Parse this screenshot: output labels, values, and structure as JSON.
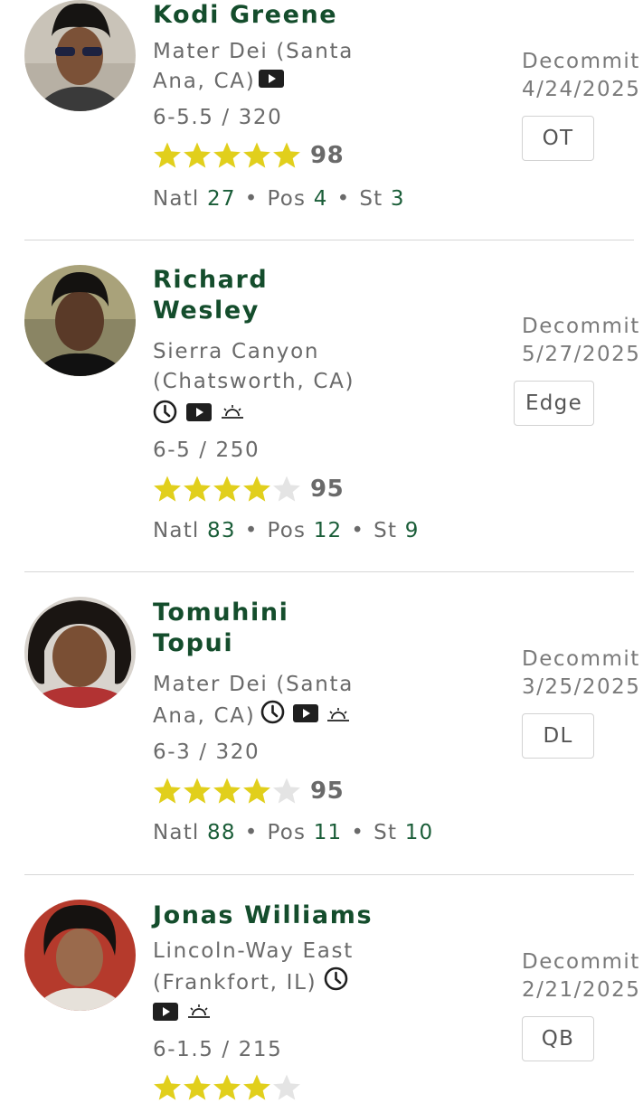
{
  "players": [
    {
      "name_line1": "Kodi Greene",
      "name_line2": "",
      "school_line1": "Mater Dei (Santa",
      "school_line2": "Ana, CA)",
      "icons": [
        "video-icon"
      ],
      "measurements": "6-5.5 / 320",
      "stars": 5,
      "rating": "98",
      "natl_label": "Natl",
      "natl": "27",
      "pos_label": "Pos",
      "pos": "4",
      "st_label": "St",
      "st": "3",
      "status_label": "Decommit",
      "status_date": "4/24/2025",
      "position": "OT"
    },
    {
      "name_line1": "Richard",
      "name_line2": "Wesley",
      "school_line1": "Sierra Canyon",
      "school_line2": "(Chatsworth, CA)",
      "icons": [
        "clock-icon",
        "video-icon",
        "sunrise-icon"
      ],
      "measurements": "6-5 / 250",
      "stars": 4,
      "rating": "95",
      "natl_label": "Natl",
      "natl": "83",
      "pos_label": "Pos",
      "pos": "12",
      "st_label": "St",
      "st": "9",
      "status_label": "Decommit",
      "status_date": "5/27/2025",
      "position": "Edge"
    },
    {
      "name_line1": "Tomuhini",
      "name_line2": "Topui",
      "school_line1": "Mater Dei (Santa",
      "school_line2": "Ana, CA)",
      "icons": [
        "clock-icon",
        "video-icon",
        "sunrise-icon"
      ],
      "measurements": "6-3 / 320",
      "stars": 4,
      "rating": "95",
      "natl_label": "Natl",
      "natl": "88",
      "pos_label": "Pos",
      "pos": "11",
      "st_label": "St",
      "st": "10",
      "status_label": "Decommit",
      "status_date": "3/25/2025",
      "position": "DL"
    },
    {
      "name_line1": "Jonas Williams",
      "name_line2": "",
      "school_line1": "Lincoln-Way East",
      "school_line2": "(Frankfort, IL)",
      "icons": [
        "clock-icon",
        "video-icon",
        "sunrise-icon"
      ],
      "measurements": "6-1.5 / 215",
      "stars": 4,
      "rating": "",
      "natl_label": "",
      "natl": "",
      "pos_label": "",
      "pos": "",
      "st_label": "",
      "st": "",
      "status_label": "Decommit",
      "status_date": "2/21/2025",
      "position": "QB"
    }
  ],
  "colors": {
    "name_green": "#144d2c",
    "rank_green": "#1a5d38",
    "star_gold": "#e1cf1c",
    "star_empty": "#e4e4e4",
    "text_gray": "#6a6a6a",
    "divider": "#d6d6d6"
  }
}
